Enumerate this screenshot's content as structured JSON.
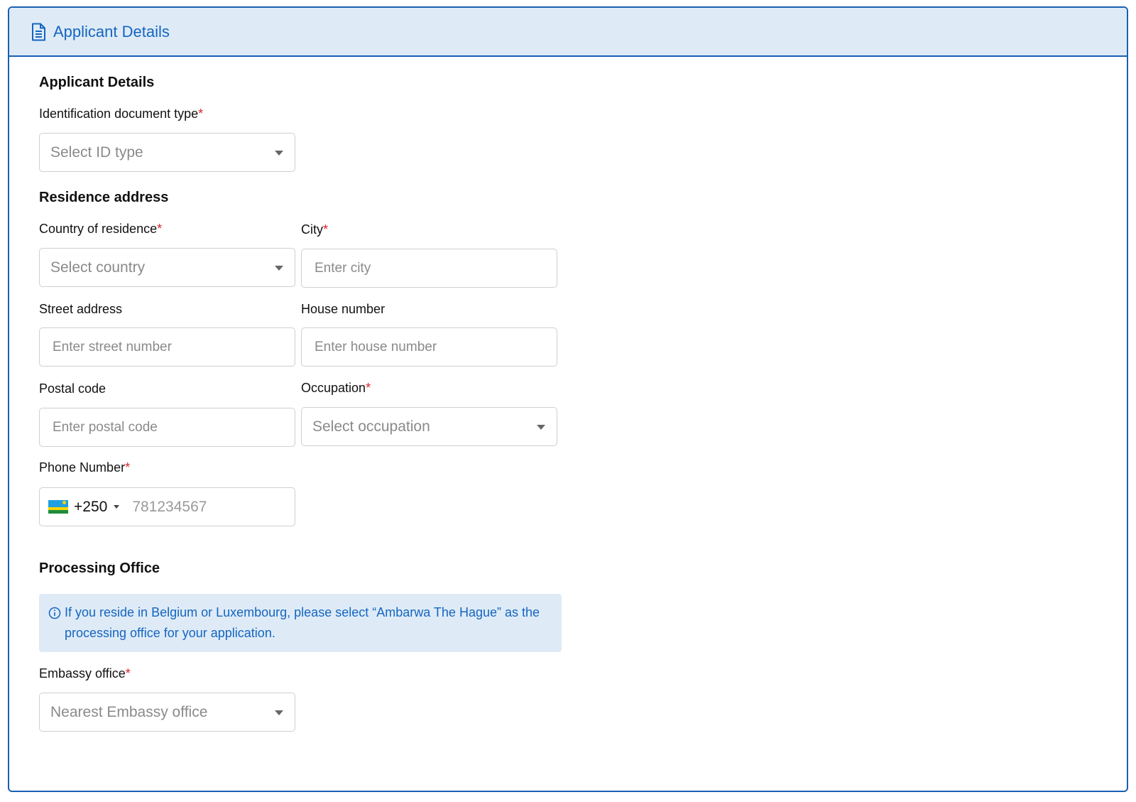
{
  "header": {
    "title": "Applicant Details",
    "icon": "document-icon"
  },
  "applicant": {
    "section_title": "Applicant Details",
    "id_type_label": "Identification document type",
    "id_type_placeholder": "Select ID type"
  },
  "residence": {
    "section_title": "Residence address",
    "country_label": "Country of residence",
    "country_placeholder": "Select country",
    "city_label": "City",
    "city_placeholder": "Enter city",
    "street_label": "Street address",
    "street_placeholder": "Enter street number",
    "house_label": "House number",
    "house_placeholder": "Enter house number",
    "postal_label": "Postal code",
    "postal_placeholder": "Enter postal code",
    "occupation_label": "Occupation",
    "occupation_placeholder": "Select occupation",
    "phone_label": "Phone Number",
    "phone_code": "+250",
    "phone_placeholder": "781234567"
  },
  "processing": {
    "section_title": "Processing Office",
    "info_text": "If you reside in Belgium or Luxembourg, please select “Ambarwa The Hague” as the processing office for your application.",
    "embassy_label": "Embassy office",
    "embassy_placeholder": "Nearest Embassy office"
  },
  "required_marker": "*",
  "colors": {
    "accent": "#1565c0",
    "border": "#1a5fb4",
    "header_bg": "#deebf7",
    "required": "#e0202a"
  }
}
